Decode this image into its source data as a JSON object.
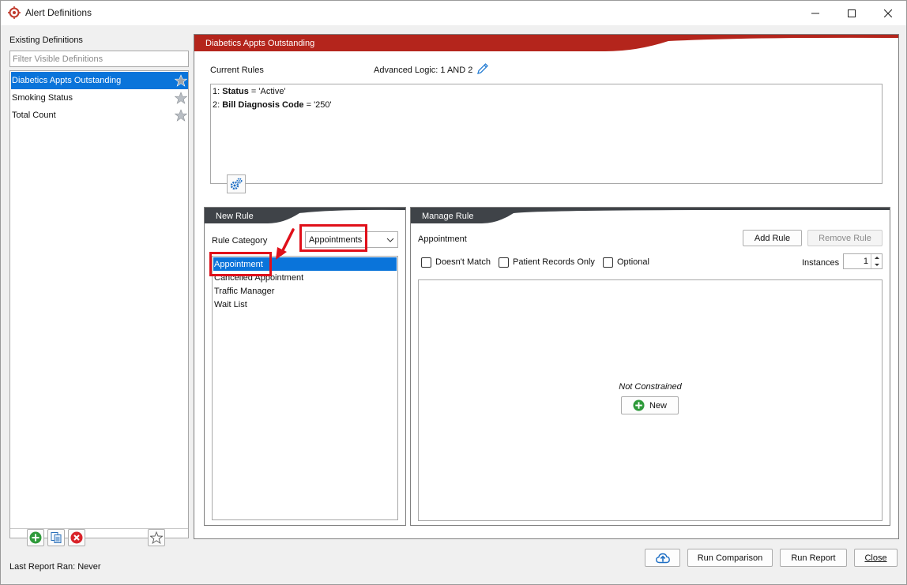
{
  "window": {
    "title": "Alert Definitions"
  },
  "left": {
    "existing_label": "Existing Definitions",
    "filter_placeholder": "Filter Visible Definitions",
    "definitions": [
      {
        "label": "Diabetics Appts Outstanding",
        "selected": true
      },
      {
        "label": "Smoking Status",
        "selected": false
      },
      {
        "label": "Total Count",
        "selected": false
      }
    ],
    "last_report": "Last Report Ran: Never"
  },
  "main": {
    "header": "Diabetics Appts Outstanding",
    "current_rules_label": "Current Rules",
    "advanced_logic": "Advanced Logic: 1 AND 2",
    "rules": [
      {
        "prefix": "1: ",
        "field": "Status",
        "rest": " = 'Active'"
      },
      {
        "prefix": "2: ",
        "field": "Bill Diagnosis Code",
        "rest": " = '250'"
      }
    ]
  },
  "new_rule": {
    "header": "New Rule",
    "category_label": "Rule Category",
    "category_value": "Appointments",
    "items": [
      "Appointment",
      "Cancelled Appointment",
      "Traffic Manager",
      "Wait List"
    ],
    "selected_index": 0
  },
  "manage_rule": {
    "header": "Manage Rule",
    "selected_label": "Appointment",
    "add_rule": "Add Rule",
    "remove_rule": "Remove Rule",
    "doesnt_match": "Doesn't Match",
    "patient_records_only": "Patient Records Only",
    "optional": "Optional",
    "instances_label": "Instances",
    "instances_value": "1",
    "not_constrained": "Not Constrained",
    "new_button": "New"
  },
  "footer": {
    "run_comparison": "Run Comparison",
    "run_report": "Run Report",
    "close": "Close"
  },
  "colors": {
    "accent_red": "#b4251c",
    "header_dark": "#3f4348",
    "selection_blue": "#0a74da",
    "annotation_red": "#e0101a"
  }
}
